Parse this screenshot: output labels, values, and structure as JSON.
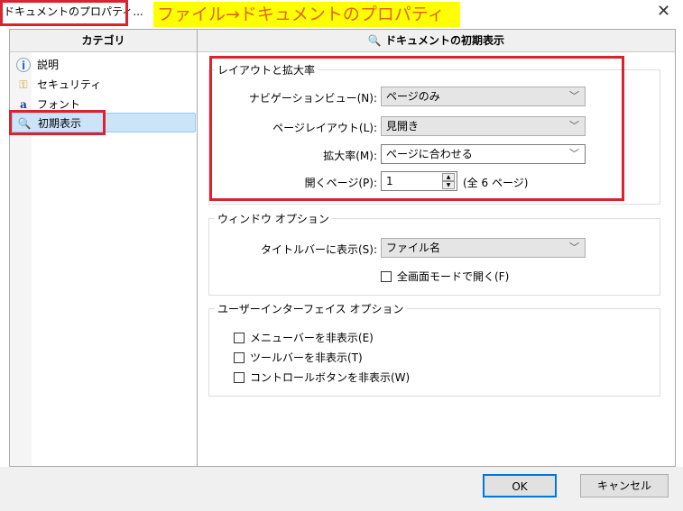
{
  "window": {
    "title": "ドキュメントのプロパティ...",
    "annotation": "ファイル→ドキュメントのプロパティ",
    "close": "✕"
  },
  "sidebar": {
    "header": "カテゴリ",
    "items": [
      {
        "label": "説明",
        "icon": "info-icon"
      },
      {
        "label": "セキュリティ",
        "icon": "keys-icon"
      },
      {
        "label": "フォント",
        "icon": "font-icon"
      },
      {
        "label": "初期表示",
        "icon": "magnifier-icon",
        "selected": true
      }
    ]
  },
  "main": {
    "header": "ドキュメントの初期表示",
    "layout_group": {
      "title": "レイアウトと拡大率",
      "nav_label": "ナビゲーションビュー(N):",
      "nav_value": "ページのみ",
      "page_layout_label": "ページレイアウト(L):",
      "page_layout_value": "見開き",
      "zoom_label": "拡大率(M):",
      "zoom_value": "ページに合わせる",
      "open_page_label": "開くページ(P):",
      "open_page_value": "1",
      "total_pages": "(全 6 ページ)"
    },
    "window_group": {
      "title": "ウィンドウ オプション",
      "titlebar_label": "タイトルバーに表示(S):",
      "titlebar_value": "ファイル名",
      "fullscreen_label": "全画面モードで開く(F)"
    },
    "ui_group": {
      "title": "ユーザーインターフェイス オプション",
      "hide_menubar": "メニューバーを非表示(E)",
      "hide_toolbar": "ツールバーを非表示(T)",
      "hide_controls": "コントロールボタンを非表示(W)"
    }
  },
  "buttons": {
    "ok": "OK",
    "cancel": "キャンセル"
  },
  "colors": {
    "highlight": "#d9232e",
    "banner": "#ffff00",
    "banner_text": "#e0641e"
  }
}
